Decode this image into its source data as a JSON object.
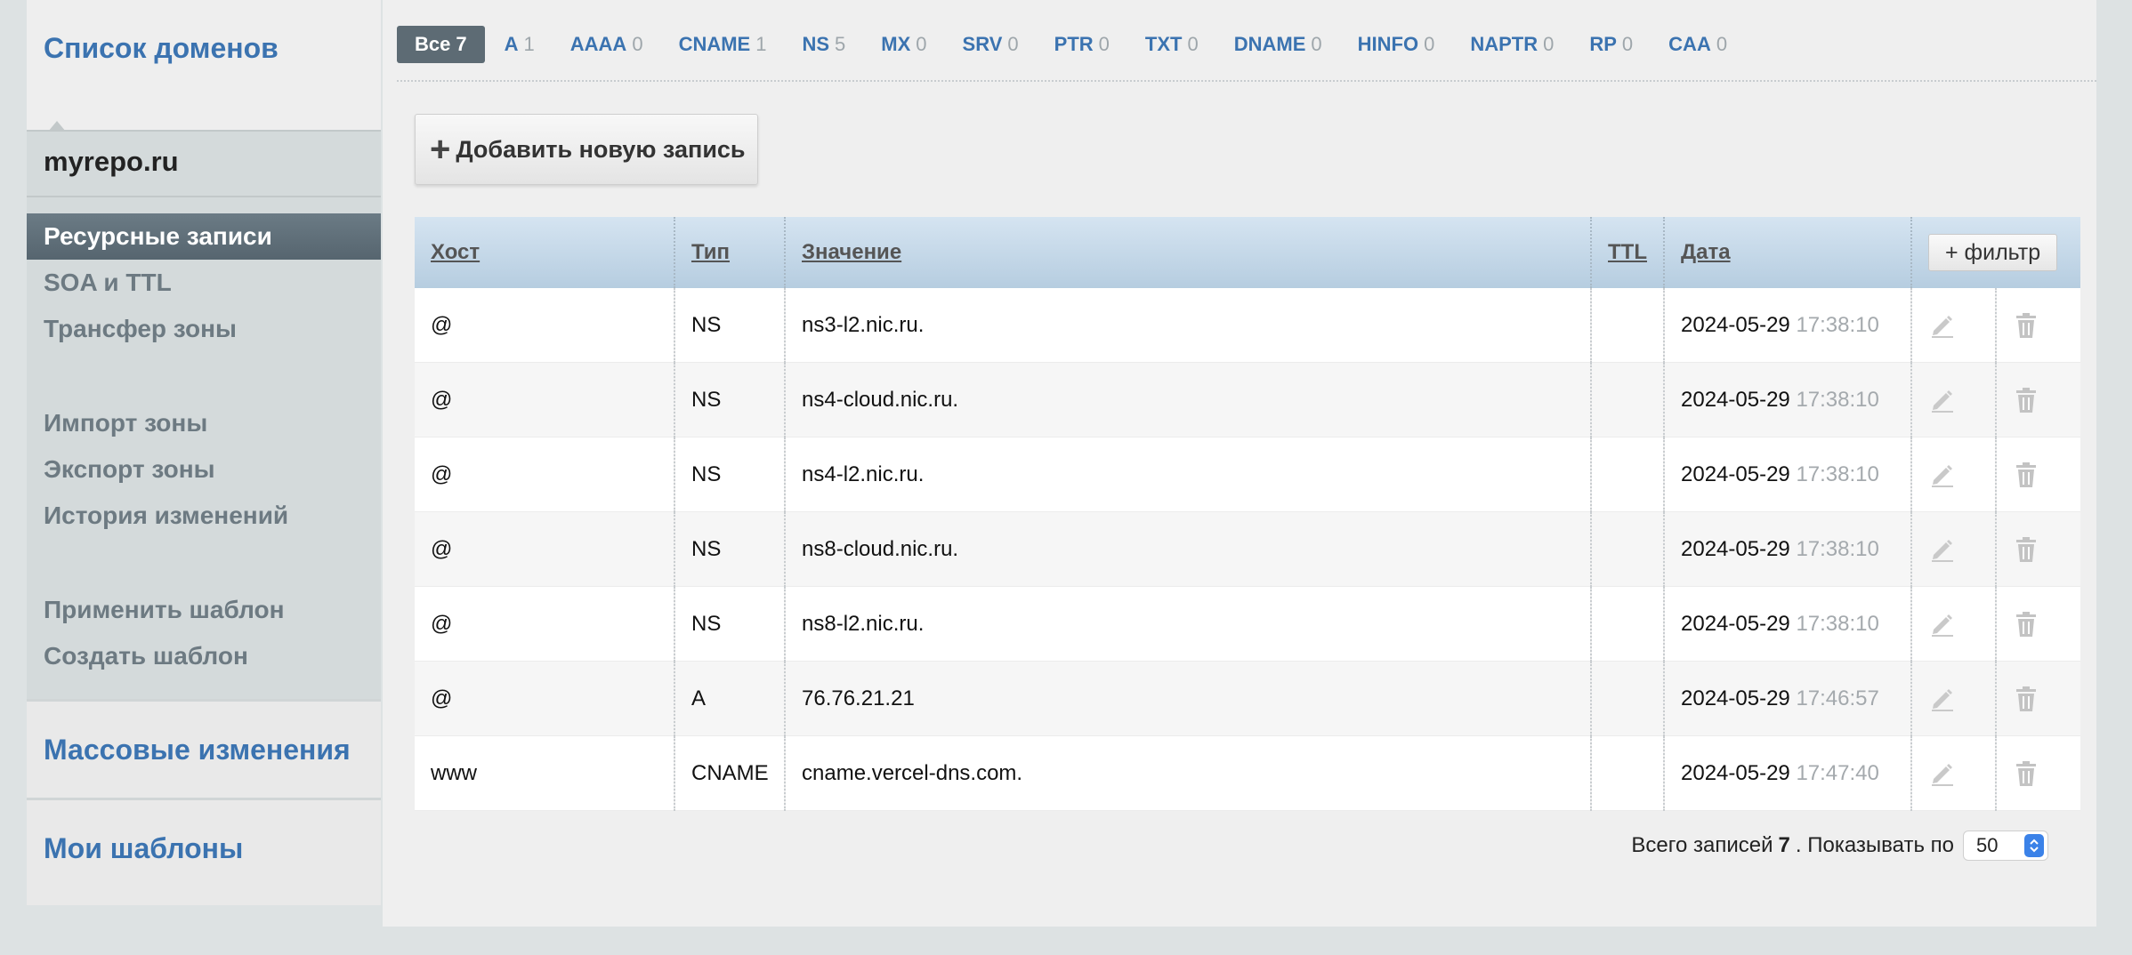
{
  "sidebar": {
    "title": "Список доменов",
    "domain": "myrepo.ru",
    "menu": [
      {
        "label": "Ресурсные записи"
      },
      {
        "label": "SOA и TTL"
      },
      {
        "label": "Трансфер зоны"
      },
      {
        "label": "Импорт зоны"
      },
      {
        "label": "Экспорт зоны"
      },
      {
        "label": "История изменений"
      },
      {
        "label": "Применить шаблон"
      },
      {
        "label": "Создать шаблон"
      }
    ],
    "mass_changes": "Массовые изменения",
    "my_templates": "Мои шаблоны"
  },
  "tabs": [
    {
      "label": "Все",
      "count": "7"
    },
    {
      "label": "A",
      "count": "1"
    },
    {
      "label": "AAAA",
      "count": "0"
    },
    {
      "label": "CNAME",
      "count": "1"
    },
    {
      "label": "NS",
      "count": "5"
    },
    {
      "label": "MX",
      "count": "0"
    },
    {
      "label": "SRV",
      "count": "0"
    },
    {
      "label": "PTR",
      "count": "0"
    },
    {
      "label": "TXT",
      "count": "0"
    },
    {
      "label": "DNAME",
      "count": "0"
    },
    {
      "label": "HINFO",
      "count": "0"
    },
    {
      "label": "NAPTR",
      "count": "0"
    },
    {
      "label": "RP",
      "count": "0"
    },
    {
      "label": "CAA",
      "count": "0"
    }
  ],
  "add_button": "Добавить новую запись",
  "table": {
    "headers": {
      "host": "Хост",
      "type": "Тип",
      "value": "Значение",
      "ttl": "TTL",
      "date": "Дата",
      "filter": "+ фильтр"
    },
    "rows": [
      {
        "host": "@",
        "type": "NS",
        "value": "ns3-l2.nic.ru.",
        "ttl": "",
        "date": "2024-05-29",
        "time": "17:38:10"
      },
      {
        "host": "@",
        "type": "NS",
        "value": "ns4-cloud.nic.ru.",
        "ttl": "",
        "date": "2024-05-29",
        "time": "17:38:10"
      },
      {
        "host": "@",
        "type": "NS",
        "value": "ns4-l2.nic.ru.",
        "ttl": "",
        "date": "2024-05-29",
        "time": "17:38:10"
      },
      {
        "host": "@",
        "type": "NS",
        "value": "ns8-cloud.nic.ru.",
        "ttl": "",
        "date": "2024-05-29",
        "time": "17:38:10"
      },
      {
        "host": "@",
        "type": "NS",
        "value": "ns8-l2.nic.ru.",
        "ttl": "",
        "date": "2024-05-29",
        "time": "17:38:10"
      },
      {
        "host": "@",
        "type": "A",
        "value": "76.76.21.21",
        "ttl": "",
        "date": "2024-05-29",
        "time": "17:46:57"
      },
      {
        "host": "www",
        "type": "CNAME",
        "value": "cname.vercel-dns.com.",
        "ttl": "",
        "date": "2024-05-29",
        "time": "17:47:40"
      }
    ]
  },
  "footer": {
    "total_label": "Всего записей",
    "total": "7",
    "show_label": ". Показывать по",
    "per_page": "50"
  },
  "colors": {
    "accent": "#3b73b0",
    "active_tab": "#5d6b74"
  }
}
